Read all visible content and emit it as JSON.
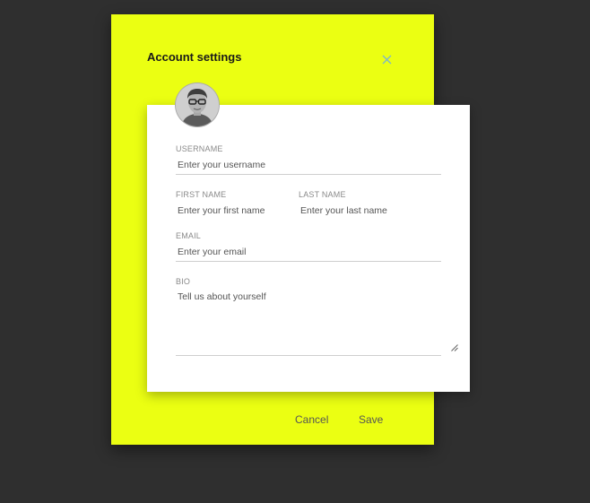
{
  "modal": {
    "title": "Account settings",
    "close_icon": "close-icon",
    "avatar_icon": "avatar-photo",
    "background_color": "#ebff12"
  },
  "form": {
    "username": {
      "label": "USERNAME",
      "placeholder": "Enter your username",
      "value": ""
    },
    "first_name": {
      "label": "FIRST NAME",
      "placeholder": "Enter your first name",
      "value": ""
    },
    "last_name": {
      "label": "LAST NAME",
      "placeholder": "Enter your last name",
      "value": ""
    },
    "email": {
      "label": "EMAIL",
      "placeholder": "Enter your email",
      "value": ""
    },
    "bio": {
      "label": "BIO",
      "placeholder": "Tell us about yourself",
      "value": ""
    }
  },
  "actions": {
    "cancel_label": "Cancel",
    "save_label": "Save"
  }
}
